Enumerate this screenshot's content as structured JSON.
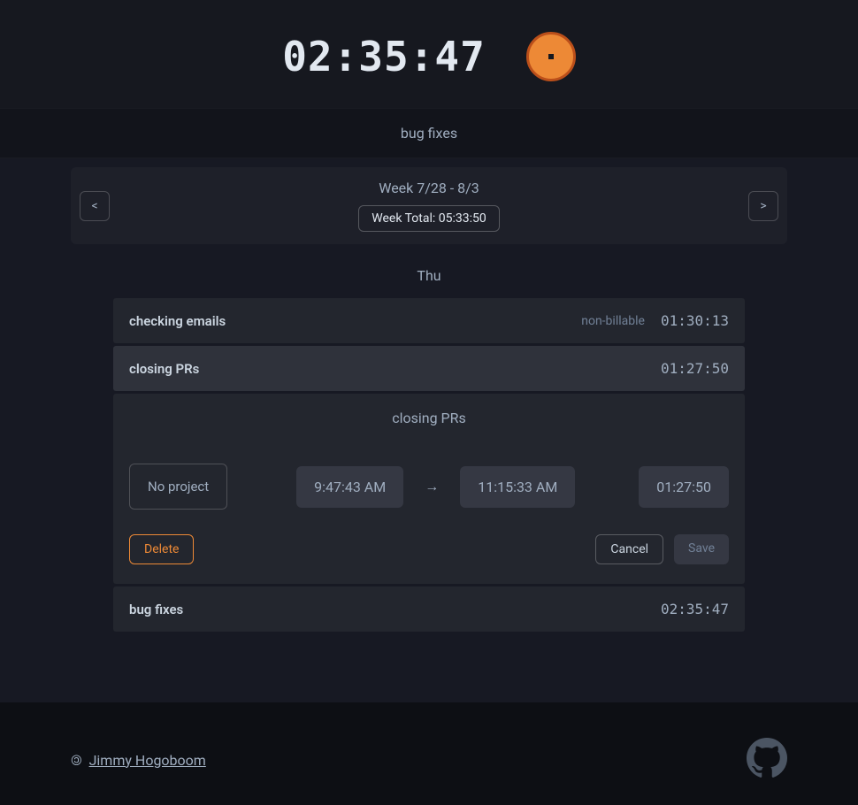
{
  "header": {
    "timer": "02:35:47"
  },
  "active_task": "bug fixes",
  "week_nav": {
    "prev": "<",
    "next": ">",
    "range": "Week 7/28 - 8/3",
    "total": "Week Total: 05:33:50"
  },
  "day": "Thu",
  "entries": [
    {
      "title": "checking emails",
      "badge": "non-billable",
      "duration": "01:30:13",
      "active": false
    },
    {
      "title": "closing PRs",
      "badge": "",
      "duration": "01:27:50",
      "active": true
    }
  ],
  "expanded": {
    "title": "closing PRs",
    "project_button": "No project",
    "start": "9:47:43 AM",
    "arrow": "→",
    "end": "11:15:33 AM",
    "duration": "01:27:50",
    "delete": "Delete",
    "cancel": "Cancel",
    "save": "Save"
  },
  "entry3": {
    "title": "bug fixes",
    "duration": "02:35:47"
  },
  "footer": {
    "sym": "©",
    "author": "Jimmy Hogoboom"
  },
  "icons": {
    "stop": "stop-icon",
    "github": "github-icon"
  }
}
